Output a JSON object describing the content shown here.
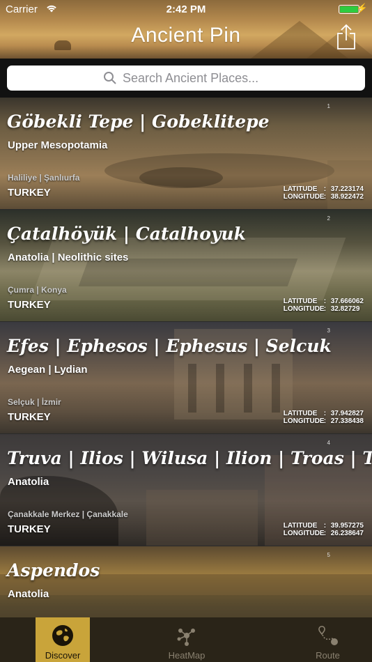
{
  "status_bar": {
    "carrier": "Carrier",
    "time": "2:42 PM"
  },
  "header": {
    "title": "Ancient Pin",
    "share_icon": "share-icon"
  },
  "search": {
    "placeholder": "Search Ancient Places...",
    "value": ""
  },
  "places": [
    {
      "index": "1",
      "title": "Göbekli Tepe | Gobeklitepe",
      "subtitle": "Upper Mesopotamia",
      "region": "Haliliye | Şanlıurfa",
      "country": "TURKEY",
      "latitude_label": "LATITUDE",
      "longitude_label": "LONGITUDE",
      "separator": ":",
      "latitude": "37.223174",
      "longitude": "38.922472"
    },
    {
      "index": "2",
      "title": "Çatalhöyük |  Catalhoyuk",
      "subtitle": "Anatolia | Neolithic sites",
      "region": "Çumra | Konya",
      "country": "TURKEY",
      "latitude_label": "LATITUDE",
      "longitude_label": "LONGITUDE",
      "separator": ":",
      "latitude": "37.666062",
      "longitude": "32.82729"
    },
    {
      "index": "3",
      "title": "Efes | Ephesos | Ephesus | Selcuk",
      "subtitle": "Aegean | Lydian",
      "region": "Selçuk | İzmir",
      "country": "TURKEY",
      "latitude_label": "LATITUDE",
      "longitude_label": "LONGITUDE",
      "separator": ":",
      "latitude": "37.942827",
      "longitude": "27.338438"
    },
    {
      "index": "4",
      "title": "Truva | Ilios | Wilusa | Ilion | Troas | Troy",
      "subtitle": "Anatolia",
      "region": "Çanakkale Merkez | Çanakkale",
      "country": "TURKEY",
      "latitude_label": "LATITUDE",
      "longitude_label": "LONGITUDE",
      "separator": ":",
      "latitude": "39.957275",
      "longitude": "26.238647"
    },
    {
      "index": "5",
      "title": "Aspendos",
      "subtitle": "Anatolia",
      "region": "",
      "country": "",
      "latitude_label": "",
      "longitude_label": "",
      "separator": "",
      "latitude": "",
      "longitude": ""
    }
  ],
  "tabs": [
    {
      "label": "Discover",
      "icon": "globe-icon",
      "selected": true
    },
    {
      "label": "HeatMap",
      "icon": "network-nodes-icon",
      "selected": false
    },
    {
      "label": "Route",
      "icon": "route-pin-icon",
      "selected": false
    }
  ],
  "colors": {
    "tab_selected": "#c9a43a",
    "tab_bar": "#2a2418",
    "battery": "#2ecc40"
  }
}
